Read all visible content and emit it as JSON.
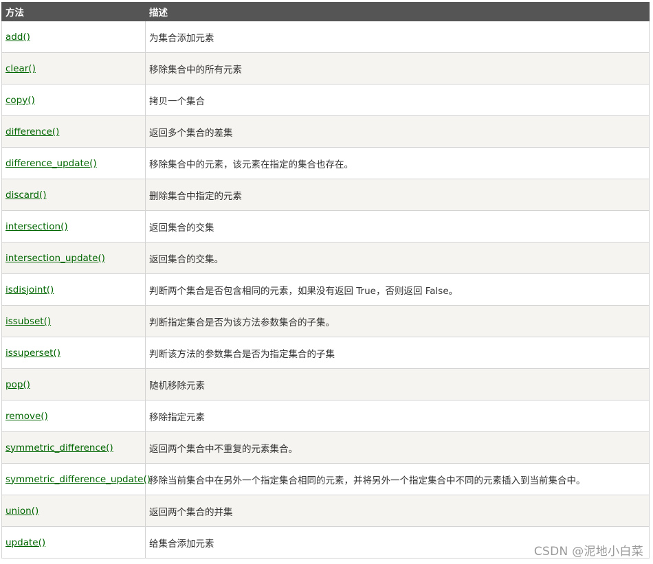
{
  "table": {
    "headers": {
      "method": "方法",
      "description": "描述"
    },
    "rows": [
      {
        "method": "add()",
        "description": "为集合添加元素"
      },
      {
        "method": "clear()",
        "description": "移除集合中的所有元素"
      },
      {
        "method": "copy()",
        "description": "拷贝一个集合"
      },
      {
        "method": "difference()",
        "description": "返回多个集合的差集"
      },
      {
        "method": "difference_update()",
        "description": "移除集合中的元素，该元素在指定的集合也存在。"
      },
      {
        "method": "discard()",
        "description": "删除集合中指定的元素"
      },
      {
        "method": "intersection()",
        "description": "返回集合的交集"
      },
      {
        "method": "intersection_update()",
        "description": "返回集合的交集。"
      },
      {
        "method": "isdisjoint()",
        "description": "判断两个集合是否包含相同的元素，如果没有返回 True，否则返回 False。"
      },
      {
        "method": "issubset()",
        "description": "判断指定集合是否为该方法参数集合的子集。"
      },
      {
        "method": "issuperset()",
        "description": "判断该方法的参数集合是否为指定集合的子集"
      },
      {
        "method": "pop()",
        "description": "随机移除元素"
      },
      {
        "method": "remove()",
        "description": "移除指定元素"
      },
      {
        "method": "symmetric_difference()",
        "description": "返回两个集合中不重复的元素集合。"
      },
      {
        "method": "symmetric_difference_update()",
        "description": "移除当前集合中在另外一个指定集合相同的元素，并将另外一个指定集合中不同的元素插入到当前集合中。"
      },
      {
        "method": "union()",
        "description": "返回两个集合的并集"
      },
      {
        "method": "update()",
        "description": "给集合添加元素"
      }
    ]
  },
  "watermark": "CSDN @泥地小白菜",
  "colors": {
    "header_bg": "#555555",
    "link": "#006600",
    "alt_row": "#f6f4f0"
  }
}
